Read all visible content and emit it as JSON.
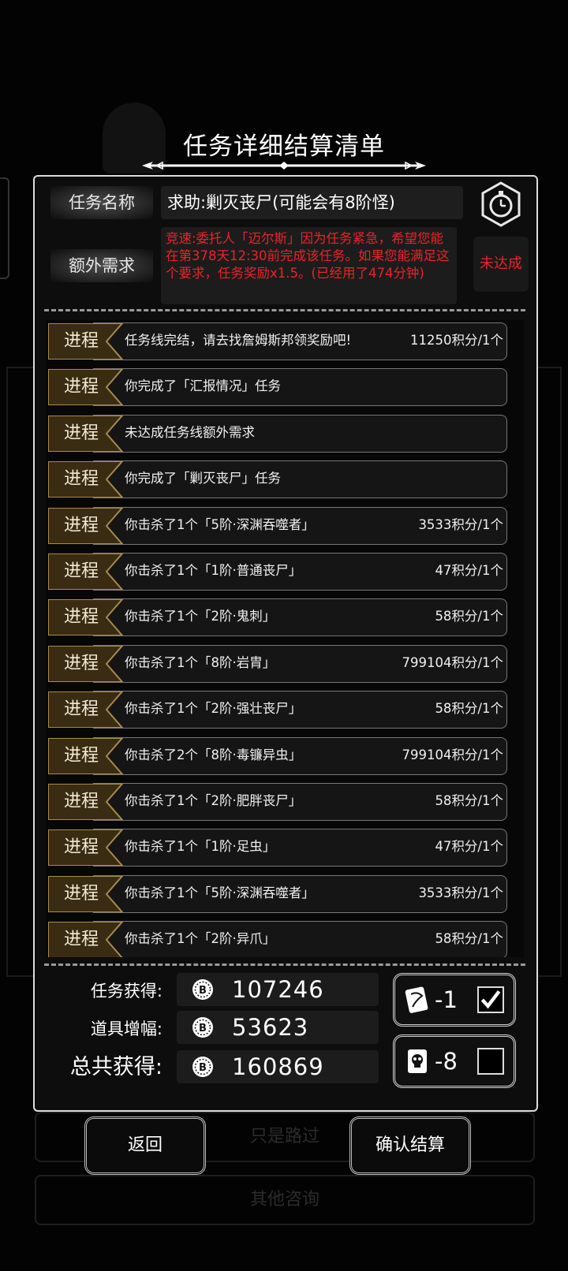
{
  "dialog": {
    "title": "任务详细结算清单",
    "name_label": "任务名称",
    "name_value": "求助:剿灭丧尸(可能会有8阶怪)",
    "extra_label": "额外需求",
    "extra_text": "竞速:委托人「迈尔斯」因为任务紧急，希望您能在第378天12:30前完成该任务。如果您能满足这个要求，任务奖励x1.5。(已经用了474分钟)",
    "extra_status": "未达成"
  },
  "progress": [
    {
      "tag": "进程",
      "text": "任务线完结，请去找詹姆斯邦领奖励吧!",
      "value": "11250积分/1个"
    },
    {
      "tag": "进程",
      "text": "你完成了「汇报情况」任务",
      "value": ""
    },
    {
      "tag": "进程",
      "text": "未达成任务线额外需求",
      "value": ""
    },
    {
      "tag": "进程",
      "text": "你完成了「剿灭丧尸」任务",
      "value": ""
    },
    {
      "tag": "进程",
      "text": "你击杀了1个「5阶·深渊吞噬者」",
      "value": "3533积分/1个"
    },
    {
      "tag": "进程",
      "text": "你击杀了1个「1阶·普通丧尸」",
      "value": "47积分/1个"
    },
    {
      "tag": "进程",
      "text": "你击杀了1个「2阶·鬼刺」",
      "value": "58积分/1个"
    },
    {
      "tag": "进程",
      "text": "你击杀了1个「8阶·岩胄」",
      "value": "799104积分/1个"
    },
    {
      "tag": "进程",
      "text": "你击杀了1个「2阶·强壮丧尸」",
      "value": "58积分/1个"
    },
    {
      "tag": "进程",
      "text": "你击杀了2个「8阶·毒镰异虫」",
      "value": "799104积分/1个"
    },
    {
      "tag": "进程",
      "text": "你击杀了1个「2阶·肥胖丧尸」",
      "value": "58积分/1个"
    },
    {
      "tag": "进程",
      "text": "你击杀了1个「1阶·足虫」",
      "value": "47积分/1个"
    },
    {
      "tag": "进程",
      "text": "你击杀了1个「5阶·深渊吞噬者」",
      "value": "3533积分/1个"
    },
    {
      "tag": "进程",
      "text": "你击杀了1个「2阶·异爪」",
      "value": "58积分/1个"
    }
  ],
  "summary": {
    "task_label": "任务获得:",
    "task_value": "107246",
    "item_label": "道具增幅:",
    "item_value": "53623",
    "total_label": "总共获得:",
    "total_value": "160869"
  },
  "items": [
    {
      "count": "-1",
      "checked": true,
      "icon": "scroll-card-icon"
    },
    {
      "count": "-8",
      "checked": false,
      "icon": "skull-card-icon"
    }
  ],
  "background": {
    "option1": "只是路过",
    "option2": "其他咨询"
  },
  "buttons": {
    "back": "返回",
    "confirm": "确认结算"
  }
}
